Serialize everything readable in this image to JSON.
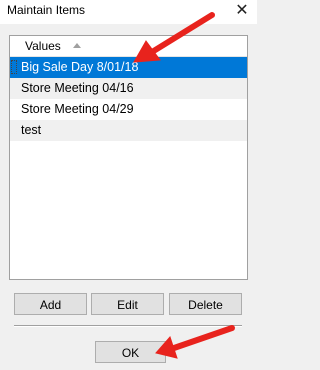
{
  "window": {
    "title": "Maintain Items",
    "close_glyph": "✕"
  },
  "list": {
    "header": "Values",
    "sort": "ascending",
    "items": [
      {
        "label": "Big Sale Day 8/01/18",
        "selected": true
      },
      {
        "label": "Store Meeting 04/16",
        "selected": false
      },
      {
        "label": "Store Meeting 04/29",
        "selected": false
      },
      {
        "label": "test",
        "selected": false
      }
    ]
  },
  "buttons": {
    "add": "Add",
    "edit": "Edit",
    "delete": "Delete",
    "ok": "OK"
  },
  "annotations": {
    "arrow_color": "#e8231d",
    "arrow_count": 2
  },
  "colors": {
    "selection": "#0078d7",
    "alt_row": "#f0f0f0"
  }
}
